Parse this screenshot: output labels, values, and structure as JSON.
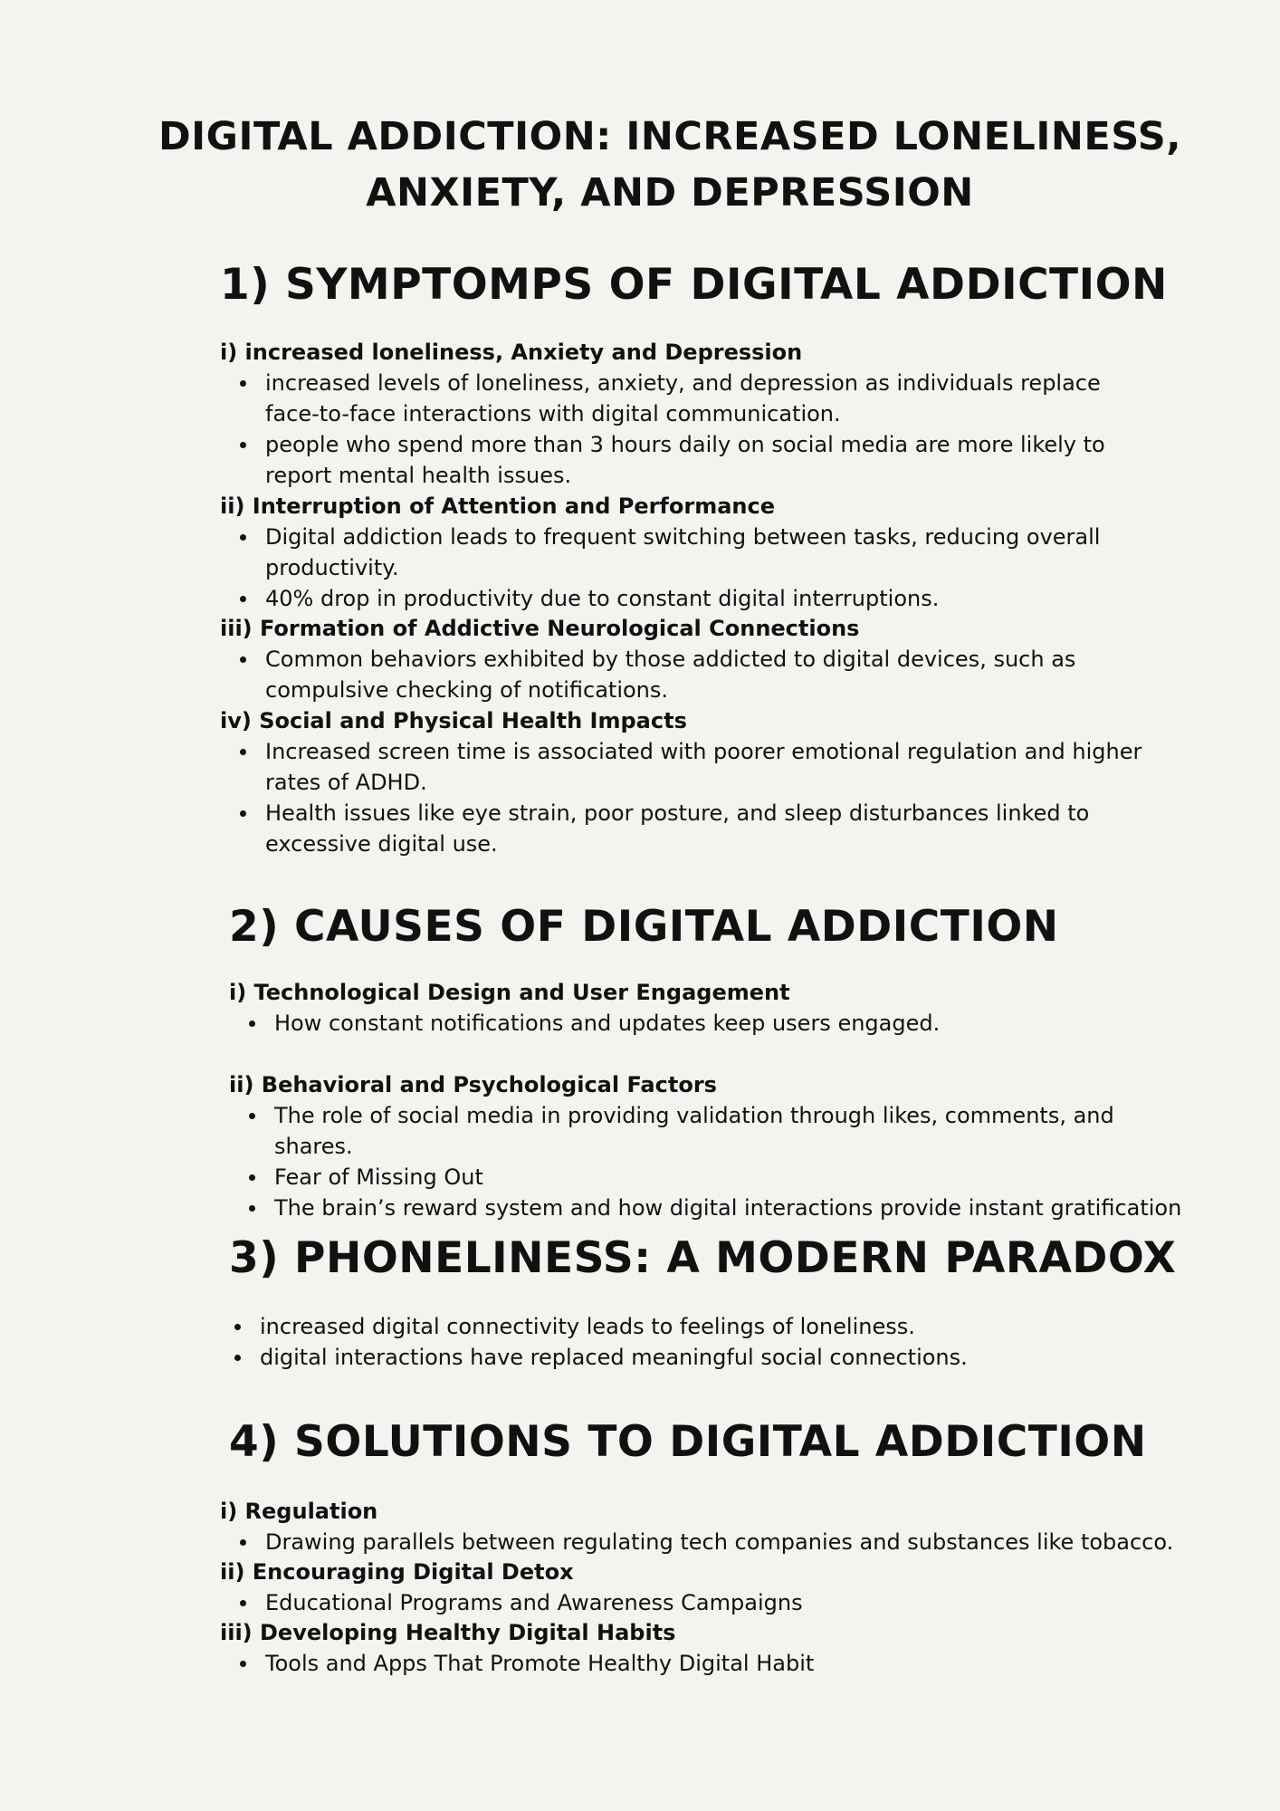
{
  "title": "DIGITAL ADDICTION: INCREASED LONELINESS, ANXIETY, AND DEPRESSION",
  "sections": [
    {
      "heading": "1) SYMPTOMPS OF DIGITAL ADDICTION",
      "subsections": [
        {
          "title": "i) increased loneliness, Anxiety and Depression",
          "bullets": [
            "increased levels of loneliness, anxiety, and depression as individuals replace face-to-face interactions with digital communication.",
            "people who spend more than 3 hours daily on social media are more likely to report mental health issues."
          ]
        },
        {
          "title": "ii) Interruption of Attention and Performance",
          "bullets": [
            "Digital addiction leads to frequent switching between tasks, reducing overall productivity.",
            "40% drop in productivity due to constant digital interruptions."
          ]
        },
        {
          "title": "iii) Formation of Addictive Neurological Connections",
          "bullets": [
            "Common behaviors exhibited by those addicted to digital devices, such as compulsive checking of notifications."
          ]
        },
        {
          "title": "iv) Social and Physical Health Impacts",
          "bullets": [
            "Increased screen time is associated with poorer emotional regulation and higher rates of ADHD.",
            "Health issues like eye strain, poor posture, and sleep disturbances linked to excessive digital use."
          ]
        }
      ]
    },
    {
      "heading": "2) CAUSES OF DIGITAL ADDICTION",
      "subsections": [
        {
          "title": "i) Technological Design and User Engagement",
          "bullets": [
            "How constant notifications and updates keep users engaged."
          ]
        },
        {
          "title": "ii) Behavioral and Psychological Factors",
          "bullets": [
            "The role of social media in providing validation through likes, comments, and shares.",
            "Fear of Missing Out",
            "The brain’s reward system and how digital interactions provide instant gratification"
          ]
        }
      ]
    },
    {
      "heading": "3) PHONELINESS: A MODERN PARADOX",
      "bullets": [
        "increased digital connectivity leads to feelings of loneliness.",
        "digital interactions have replaced meaningful social connections."
      ]
    },
    {
      "heading": "4) SOLUTIONS TO DIGITAL ADDICTION",
      "subsections": [
        {
          "title": "i) Regulation",
          "bullets": [
            "Drawing parallels between regulating tech companies and substances like tobacco."
          ]
        },
        {
          "title": "ii) Encouraging Digital Detox",
          "bullets": [
            "Educational Programs and Awareness Campaigns"
          ]
        },
        {
          "title": "iii) Developing Healthy Digital Habits",
          "bullets": [
            "Tools and Apps That Promote Healthy Digital Habit"
          ]
        }
      ]
    }
  ]
}
